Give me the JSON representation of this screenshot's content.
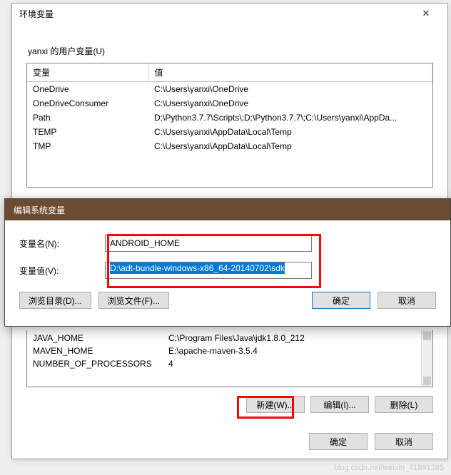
{
  "mainDialog": {
    "title": "环境变量",
    "close": "✕",
    "userSectionLabel": "yanxi 的用户变量(U)",
    "columns": {
      "name": "变量",
      "value": "值"
    },
    "userVars": [
      {
        "name": "OneDrive",
        "value": "C:\\Users\\yanxi\\OneDrive"
      },
      {
        "name": "OneDriveConsumer",
        "value": "C:\\Users\\yanxi\\OneDrive"
      },
      {
        "name": "Path",
        "value": "D:\\Python3.7.7\\Scripts\\;D:\\Python3.7.7\\;C:\\Users\\yanxi\\AppDa..."
      },
      {
        "name": "TEMP",
        "value": "C:\\Users\\yanxi\\AppData\\Local\\Temp"
      },
      {
        "name": "TMP",
        "value": "C:\\Users\\yanxi\\AppData\\Local\\Temp"
      }
    ],
    "sysVars": [
      {
        "name": "JAVA_HOME",
        "value": "C:\\Program Files\\Java\\jdk1.8.0_212"
      },
      {
        "name": "MAVEN_HOME",
        "value": "E:\\apache-maven-3.5.4"
      },
      {
        "name": "NUMBER_OF_PROCESSORS",
        "value": "4"
      }
    ],
    "buttons": {
      "new": "新建(W)...",
      "edit": "编辑(I)...",
      "delete": "删除(L)",
      "ok": "确定",
      "cancel": "取消"
    }
  },
  "editDialog": {
    "title": "编辑系统变量",
    "nameLabel": "变量名(N):",
    "valueLabel": "变量值(V):",
    "nameValue": "ANDROID_HOME",
    "valueValue": "D:\\adt-bundle-windows-x86_64-20140702\\sdk",
    "browseDir": "浏览目录(D)...",
    "browseFile": "浏览文件(F)...",
    "ok": "确定",
    "cancel": "取消"
  },
  "watermark": "blog.csdn.net/weixin_41891385"
}
